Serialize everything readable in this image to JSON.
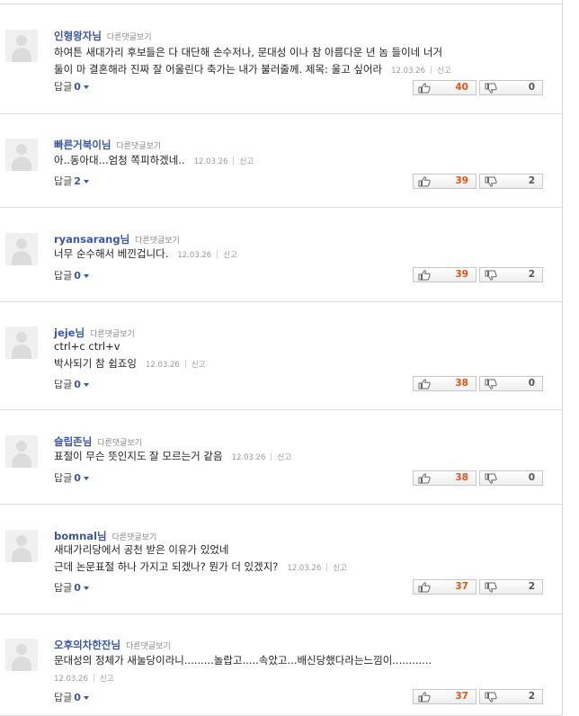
{
  "ui": {
    "others_label": "다른댓글보기",
    "reply_label": "답글",
    "report_label": "신고"
  },
  "comments": [
    {
      "author": "인형왕자님",
      "lines": [
        "하여튼 새대가리 후보들은 다 대단해 손수저나, 문대성 이나 참 아름다운 년 놈 들이네 너거",
        "둘이 마 결혼해라 진짜 잘 어울린다 축가는 내가 불러줄께. 제목: 울고 싶어라"
      ],
      "date": "12.03.26",
      "replies": "0",
      "up": "40",
      "down": "0"
    },
    {
      "author": "빠른거북이님",
      "lines": [
        "아..동아대...엄청 쪽피하겠네.."
      ],
      "date": "12.03.26",
      "replies": "2",
      "up": "39",
      "down": "2"
    },
    {
      "author": "ryansarang님",
      "lines": [
        "너무 순수해서 베낀겁니다."
      ],
      "date": "12.03.26",
      "replies": "0",
      "up": "39",
      "down": "2"
    },
    {
      "author": "jeje님",
      "lines": [
        "ctrl+c ctrl+v",
        "박사되기 참 쉽죠잉"
      ],
      "date": "12.03.26",
      "replies": "0",
      "up": "38",
      "down": "0"
    },
    {
      "author": "슬립존님",
      "lines": [
        "표절이 무슨 뜻인지도 잘 모르는거 같음"
      ],
      "date": "12.03.26",
      "replies": "0",
      "up": "38",
      "down": "0"
    },
    {
      "author": "bomnal님",
      "lines": [
        "새대가리당에서 공천 받은 이유가 있었네",
        "근데 논문표절 하나 가지고 되겠나? 뭔가 더 있겠지?"
      ],
      "date": "12.03.26",
      "replies": "0",
      "up": "37",
      "down": "2"
    },
    {
      "author": "오후의차한잔님",
      "lines": [
        "문대성의 정체가 새눌당이라니.........놀랍고.....속았고...배신당했다라는느낌이............"
      ],
      "date": "12.03.26",
      "replies": "0",
      "up": "37",
      "down": "2"
    }
  ]
}
